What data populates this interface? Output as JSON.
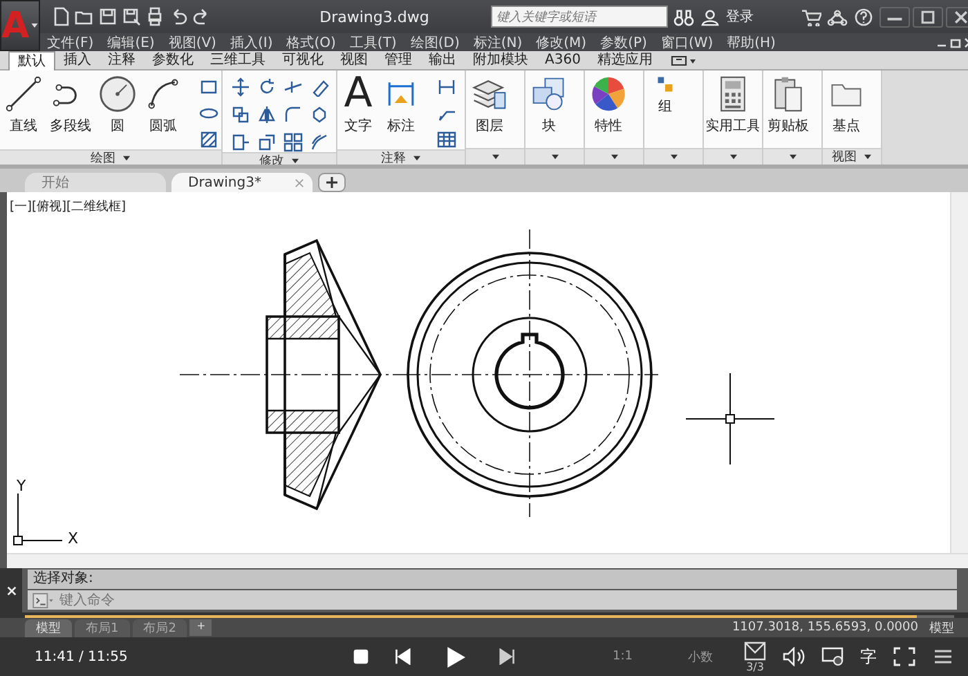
{
  "window": {
    "logo": "A",
    "title": "Drawing3.dwg",
    "search_placeholder": "键入关键字或短语",
    "user": "登录"
  },
  "menu": [
    "文件(F)",
    "编辑(E)",
    "视图(V)",
    "插入(I)",
    "格式(O)",
    "工具(T)",
    "绘图(D)",
    "标注(N)",
    "修改(M)",
    "参数(P)",
    "窗口(W)",
    "帮助(H)"
  ],
  "ribbon_tabs": [
    {
      "label": "默认",
      "selected": true
    },
    {
      "label": "插入",
      "selected": false
    },
    {
      "label": "注释",
      "selected": false
    },
    {
      "label": "参数化",
      "selected": false
    },
    {
      "label": "三维工具",
      "selected": false
    },
    {
      "label": "可视化",
      "selected": false
    },
    {
      "label": "视图",
      "selected": false
    },
    {
      "label": "管理",
      "selected": false
    },
    {
      "label": "输出",
      "selected": false
    },
    {
      "label": "附加模块",
      "selected": false
    },
    {
      "label": "A360",
      "selected": false
    },
    {
      "label": "精选应用",
      "selected": false
    }
  ],
  "ribbon_panels": [
    {
      "title": "绘图",
      "tools": [
        {
          "label": "直线",
          "kind": "line"
        },
        {
          "label": "多段线",
          "kind": "polyline"
        },
        {
          "label": "圆",
          "kind": "circle"
        },
        {
          "label": "圆弧",
          "kind": "arc"
        }
      ]
    },
    {
      "title": "修改"
    },
    {
      "title": "注释",
      "tools": [
        {
          "label": "文字",
          "kind": "text",
          "glyph": "A"
        },
        {
          "label": "标注",
          "kind": "dimension"
        }
      ]
    },
    {
      "tools": [
        {
          "label": "图层",
          "kind": "layers"
        }
      ]
    },
    {
      "tools": [
        {
          "label": "块",
          "kind": "block"
        }
      ]
    },
    {
      "tools": [
        {
          "label": "特性",
          "kind": "properties"
        }
      ]
    },
    {
      "tools": [
        {
          "label": "组",
          "kind": "group"
        }
      ]
    },
    {
      "tools": [
        {
          "label": "实用工具",
          "kind": "calculator"
        }
      ]
    },
    {
      "tools": [
        {
          "label": "剪贴板",
          "kind": "clipboard"
        }
      ]
    },
    {
      "title": "视图",
      "tools": [
        {
          "label": "基点",
          "kind": "folder"
        }
      ]
    }
  ],
  "doc_tabs": [
    {
      "label": "开始",
      "selected": false
    },
    {
      "label": "Drawing3*",
      "selected": true
    }
  ],
  "viewport_label": "[一][俯视][二维线框]",
  "axes": {
    "x": "X",
    "y": "Y"
  },
  "command": {
    "history": "选择对象:",
    "placeholder": "键入命令"
  },
  "layout_tabs": [
    {
      "label": "模型",
      "selected": true
    },
    {
      "label": "布局1",
      "selected": false
    },
    {
      "label": "布局2",
      "selected": false
    }
  ],
  "add_layout": "+",
  "status": {
    "coordinates": "1107.3018, 155.6593, 0.0000",
    "space": "模型",
    "scale": "1:1",
    "units": "小数"
  },
  "player": {
    "time": "11:41 / 11:55",
    "level": 0.96,
    "playing": false,
    "counter": "3/3",
    "subtitle_glyph": "字"
  }
}
